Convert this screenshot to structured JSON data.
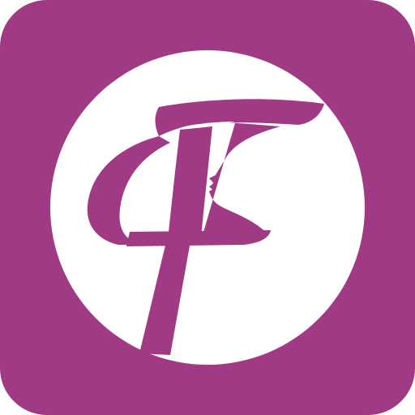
{
  "icon": {
    "name": "app-launcher-icon",
    "shape": "rounded-square",
    "symbol": "stylized-letter-f-with-female-profile",
    "colors": {
      "background": "#a03a85",
      "circle": "#ffffff",
      "glyph": "#a03a85"
    }
  }
}
